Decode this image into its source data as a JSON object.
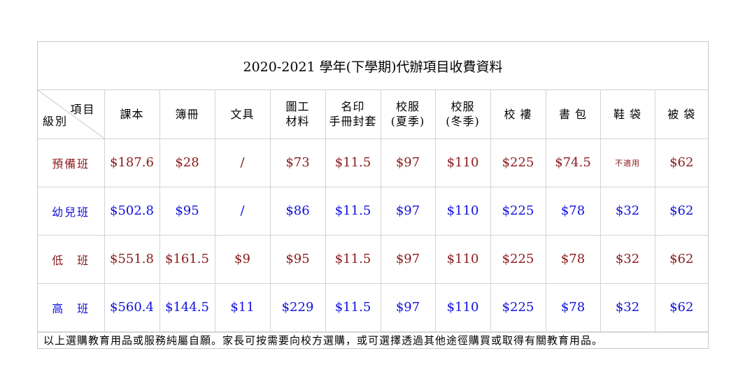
{
  "title": "2020-2021 學年(下學期)代辦項目收費資料",
  "corner": {
    "top": "項目",
    "bottom": "級別"
  },
  "headers": [
    [
      "課本"
    ],
    [
      "簿冊"
    ],
    [
      "文具"
    ],
    [
      "圖工",
      "材料"
    ],
    [
      "名印",
      "手冊封套"
    ],
    [
      "校服",
      "(夏季)"
    ],
    [
      "校服",
      "(冬季)"
    ],
    [
      "校 褸"
    ],
    [
      "書 包"
    ],
    [
      "鞋 袋"
    ],
    [
      "被 袋"
    ]
  ],
  "colors": {
    "row_odd": "#8b1a1a",
    "row_even": "#1010e0"
  },
  "rows": [
    {
      "name": "預備班",
      "color": "#8b1a1a",
      "values": [
        "$187.6",
        "$28",
        "/",
        "$73",
        "$11.5",
        "$97",
        "$110",
        "$225",
        "$74.5",
        "不適用",
        "$62"
      ]
    },
    {
      "name": "幼兒班",
      "color": "#1010e0",
      "values": [
        "$502.8",
        "$95",
        "/",
        "$86",
        "$11.5",
        "$97",
        "$110",
        "$225",
        "$78",
        "$32",
        "$62"
      ]
    },
    {
      "name": "低　班",
      "color": "#8b1a1a",
      "values": [
        "$551.8",
        "$161.5",
        "$9",
        "$95",
        "$11.5",
        "$97",
        "$110",
        "$225",
        "$78",
        "$32",
        "$62"
      ]
    },
    {
      "name": "高　班",
      "color": "#1010e0",
      "values": [
        "$560.4",
        "$144.5",
        "$11",
        "$229",
        "$11.5",
        "$97",
        "$110",
        "$225",
        "$78",
        "$32",
        "$62"
      ]
    }
  ],
  "footnote": "以上選購教育用品或服務純屬自願。家長可按需要向校方選購，或可選擇透過其他途徑購買或取得有關教育用品。"
}
